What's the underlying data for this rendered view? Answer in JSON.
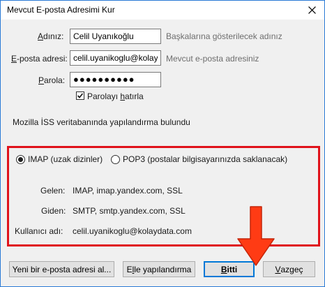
{
  "window": {
    "title": "Mevcut E-posta Adresimi Kur"
  },
  "form": {
    "name": {
      "label": "Adınız:",
      "value": "Celil Uyanıkoğlu",
      "hint": "Başkalarına gösterilecek adınız"
    },
    "email": {
      "label": "E-posta adresi:",
      "value": "celil.uyanikoglu@kolay",
      "hint": "Mevcut e-posta adresiniz"
    },
    "password": {
      "label": "Parola:",
      "value": "●●●●●●●●●●"
    },
    "remember": {
      "label": "Parolayı hatırla",
      "checked": true
    }
  },
  "status_text": "Mozilla İSS veritabanında yapılandırma bulundu",
  "protocol": {
    "imap_label": "IMAP (uzak dizinler)",
    "pop3_label": "POP3 (postalar bilgisayarınızda saklanacak)",
    "selected": "imap"
  },
  "details": {
    "incoming_label": "Gelen:",
    "incoming_value": "IMAP, imap.yandex.com, SSL",
    "outgoing_label": "Giden:",
    "outgoing_value": "SMTP, smtp.yandex.com, SSL",
    "username_label": "Kullanıcı adı:",
    "username_value": "celil.uyanikoglu@kolaydata.com"
  },
  "buttons": {
    "new_address": "Yeni bir e-posta adresi al...",
    "manual": "Elle yapılandırma",
    "done": "Bitti",
    "cancel": "Vazgeç"
  },
  "colors": {
    "highlight_border": "#e0121b",
    "arrow": "#ff3b14"
  }
}
